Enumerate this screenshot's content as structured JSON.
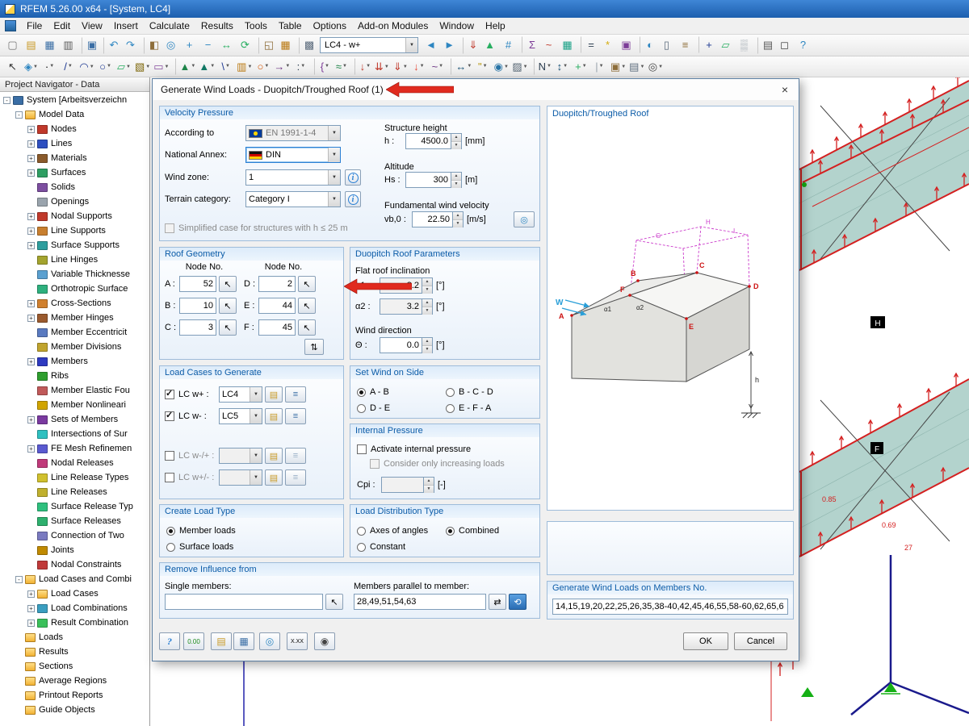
{
  "window": {
    "title": "RFEM 5.26.00 x64 - [System, LC4]"
  },
  "menu": {
    "items": [
      "File",
      "Edit",
      "View",
      "Insert",
      "Calculate",
      "Results",
      "Tools",
      "Table",
      "Options",
      "Add-on Modules",
      "Window",
      "Help"
    ]
  },
  "toolbar1": {
    "combo_value": "LC4 - w+",
    "left": [
      {
        "n": "new-file-icon",
        "g": "▢",
        "c": "#777777"
      },
      {
        "n": "open-file-icon",
        "g": "▤",
        "c": "#c99a27"
      },
      {
        "n": "save-icon",
        "g": "▦",
        "c": "#3a6ea5"
      },
      {
        "n": "print-icon",
        "g": "▥",
        "c": "#5a5a5a"
      },
      {
        "n": "copy-icon",
        "g": "▣",
        "c": "#3a6ea5",
        "sep": true
      },
      {
        "n": "undo-icon",
        "g": "↶",
        "c": "#2e86c1",
        "sep": true
      },
      {
        "n": "redo-icon",
        "g": "↷",
        "c": "#2e86c1"
      },
      {
        "n": "render-mode-icon",
        "g": "◧",
        "c": "#8e6e3a",
        "sep": true
      },
      {
        "n": "zoom-window-icon",
        "g": "◎",
        "c": "#2e86c1"
      },
      {
        "n": "zoom-in-icon",
        "g": "+",
        "c": "#2e86c1"
      },
      {
        "n": "zoom-out-icon",
        "g": "−",
        "c": "#2e86c1"
      },
      {
        "n": "move-view-icon",
        "g": "↔",
        "c": "#27ae60"
      },
      {
        "n": "rotate-view-icon",
        "g": "⟳",
        "c": "#27ae60"
      },
      {
        "n": "isometric-view-icon",
        "g": "◱",
        "c": "#8e6e3a",
        "sep": true
      },
      {
        "n": "tables-icon",
        "g": "▦",
        "c": "#b9770e"
      },
      {
        "n": "snap-grid-icon",
        "g": "▩",
        "c": "#5d6d7e",
        "sep": true
      }
    ],
    "right": [
      {
        "n": "previous-load-case-icon",
        "g": "◄",
        "c": "#2e86c1"
      },
      {
        "n": "next-load-case-icon",
        "g": "►",
        "c": "#2e86c1"
      },
      {
        "n": "show-loads-icon",
        "g": "⇓",
        "c": "#c0392b",
        "sep": true
      },
      {
        "n": "show-supports-icon",
        "g": "▲",
        "c": "#27ae60"
      },
      {
        "n": "show-numbering-icon",
        "g": "#",
        "c": "#2e86c1"
      },
      {
        "n": "show-values-icon",
        "g": "Σ",
        "c": "#7d3c98",
        "sep": true
      },
      {
        "n": "show-results-icon",
        "g": "~",
        "c": "#c0392b"
      },
      {
        "n": "fe-mesh-icon",
        "g": "▦",
        "c": "#16a085"
      },
      {
        "n": "calculation-icon",
        "g": "=",
        "c": "#2c3e50",
        "sep": true
      },
      {
        "n": "generators-icon",
        "g": "*",
        "c": "#d4ac0d"
      },
      {
        "n": "modules-icon",
        "g": "▣",
        "c": "#7d3c98"
      },
      {
        "n": "display-properties-icon",
        "g": "◐",
        "c": "#2e86c1",
        "sep": true
      },
      {
        "n": "control-panel-icon",
        "g": "▯",
        "c": "#5d6d7e"
      },
      {
        "n": "layers-icon",
        "g": "≡",
        "c": "#8e6e3a"
      },
      {
        "n": "axes-icon",
        "g": "+",
        "c": "#1f3a93",
        "sep": true
      },
      {
        "n": "work-plane-icon",
        "g": "▱",
        "c": "#27ae60"
      },
      {
        "n": "background-icon",
        "g": "▒",
        "c": "#9aa4ad"
      },
      {
        "n": "print-preview-icon",
        "g": "▤",
        "c": "#5a5a5a",
        "sep": true
      },
      {
        "n": "full-screen-icon",
        "g": "◻",
        "c": "#444444"
      },
      {
        "n": "help-icon",
        "g": "?",
        "c": "#2e86c1"
      }
    ]
  },
  "toolbar2": {
    "icons": [
      {
        "n": "select-icon",
        "g": "↖",
        "c": "#333333"
      },
      {
        "n": "snap-node-icon",
        "g": "◈",
        "c": "#2e86c1",
        "d": true
      },
      {
        "n": "node-icon",
        "g": "·",
        "c": "#000000",
        "d": true
      },
      {
        "n": "line-icon",
        "g": "/",
        "c": "#1f3a93",
        "d": true
      },
      {
        "n": "arc-icon",
        "g": "◠",
        "c": "#1f3a93",
        "d": true
      },
      {
        "n": "circle-icon",
        "g": "○",
        "c": "#1f3a93",
        "d": true
      },
      {
        "n": "surface-icon",
        "g": "▱",
        "c": "#27ae60",
        "d": true
      },
      {
        "n": "solid-icon",
        "g": "▧",
        "c": "#7d6608",
        "d": true
      },
      {
        "n": "opening-icon",
        "g": "▭",
        "c": "#884ea0",
        "d": true
      },
      {
        "n": "nodal-support-icon",
        "g": "▲",
        "c": "#1e8449",
        "d": true,
        "sep": true
      },
      {
        "n": "line-support-icon",
        "g": "▲",
        "c": "#117864",
        "d": true
      },
      {
        "n": "member-icon",
        "g": "\\",
        "c": "#1f3a93",
        "d": true
      },
      {
        "n": "cross-section-icon",
        "g": "▥",
        "c": "#b9770e",
        "d": true
      },
      {
        "n": "hinge-icon",
        "g": "○",
        "c": "#d35400",
        "d": true
      },
      {
        "n": "eccentricity-icon",
        "g": "→",
        "c": "#6c3483",
        "d": true
      },
      {
        "n": "division-icon",
        "g": ":",
        "c": "#2c3e50",
        "d": true
      },
      {
        "n": "set-of-members-icon",
        "g": "{",
        "c": "#7d3c98",
        "d": true,
        "sep": true
      },
      {
        "n": "rib-icon",
        "g": "≈",
        "c": "#1e8449",
        "d": true
      },
      {
        "n": "nodal-load-icon",
        "g": "↓",
        "c": "#c0392b",
        "d": true,
        "sep": true
      },
      {
        "n": "member-load-icon",
        "g": "⇊",
        "c": "#c0392b",
        "d": true
      },
      {
        "n": "surface-load-icon",
        "g": "⇓",
        "c": "#c0392b",
        "d": true
      },
      {
        "n": "free-load-icon",
        "g": "↓",
        "c": "#e74c3c",
        "d": true
      },
      {
        "n": "imperfection-icon",
        "g": "~",
        "c": "#6c3483",
        "d": true
      },
      {
        "n": "dimension-icon",
        "g": "↔",
        "c": "#1a5276",
        "d": true,
        "sep": true
      },
      {
        "n": "comment-icon",
        "g": "\"",
        "c": "#b7950b",
        "d": true
      },
      {
        "n": "visibility-icon",
        "g": "◉",
        "c": "#2874a6",
        "d": true
      },
      {
        "n": "clipping-plane-icon",
        "g": "▨",
        "c": "#566573",
        "d": true
      },
      {
        "n": "renumber-icon",
        "g": "N",
        "c": "#2c3e50",
        "d": true,
        "sep": true
      },
      {
        "n": "measure-icon",
        "g": "↕",
        "c": "#1a5276",
        "d": true
      },
      {
        "n": "coordinate-system-icon",
        "g": "+",
        "c": "#27ae60",
        "d": true
      },
      {
        "n": "guideline-icon",
        "g": "|",
        "c": "#9aa4ad",
        "d": true
      },
      {
        "n": "block-icon",
        "g": "▣",
        "c": "#8e6e3a",
        "d": true
      },
      {
        "n": "dxf-icon",
        "g": "▤",
        "c": "#5d6d7e",
        "d": true
      },
      {
        "n": "settings-icon",
        "g": "◎",
        "c": "#444444",
        "d": true
      }
    ]
  },
  "navigator": {
    "title": "Project Navigator - Data",
    "tree": [
      {
        "label": "System [Arbeitsverzeichn",
        "lvl": 0,
        "exp": "-",
        "c": "#3a6ea5"
      },
      {
        "label": "Model Data",
        "lvl": 1,
        "exp": "-",
        "folder": true
      },
      {
        "label": "Nodes",
        "lvl": 2,
        "exp": "+",
        "c": "#c0392b"
      },
      {
        "label": "Lines",
        "lvl": 2,
        "exp": "+",
        "c": "#2e4fc0"
      },
      {
        "label": "Materials",
        "lvl": 2,
        "exp": "+",
        "c": "#8a5a2b"
      },
      {
        "label": "Surfaces",
        "lvl": 2,
        "exp": "+",
        "c": "#2e9e62"
      },
      {
        "label": "Solids",
        "lvl": 2,
        "exp": "",
        "c": "#7d4fa0"
      },
      {
        "label": "Openings",
        "lvl": 2,
        "exp": "",
        "c": "#9aa4ad"
      },
      {
        "label": "Nodal Supports",
        "lvl": 2,
        "exp": "+",
        "c": "#c0392b"
      },
      {
        "label": "Line Supports",
        "lvl": 2,
        "exp": "+",
        "c": "#c87f2f"
      },
      {
        "label": "Surface Supports",
        "lvl": 2,
        "exp": "+",
        "c": "#2e9e9e"
      },
      {
        "label": "Line Hinges",
        "lvl": 2,
        "exp": "",
        "c": "#a4a42e"
      },
      {
        "label": "Variable Thicknesse",
        "lvl": 2,
        "exp": "",
        "c": "#5aa0d0"
      },
      {
        "label": "Orthotropic Surface",
        "lvl": 2,
        "exp": "",
        "c": "#2eb07e"
      },
      {
        "label": "Cross-Sections",
        "lvl": 2,
        "exp": "+",
        "c": "#d0802e"
      },
      {
        "label": "Member Hinges",
        "lvl": 2,
        "exp": "+",
        "c": "#9a5a2e"
      },
      {
        "label": "Member Eccentricit",
        "lvl": 2,
        "exp": "",
        "c": "#5a7ac0"
      },
      {
        "label": "Member Divisions",
        "lvl": 2,
        "exp": "",
        "c": "#c0a42e"
      },
      {
        "label": "Members",
        "lvl": 2,
        "exp": "+",
        "c": "#2e3ac0"
      },
      {
        "label": "Ribs",
        "lvl": 2,
        "exp": "",
        "c": "#2e9e2e"
      },
      {
        "label": "Member Elastic Fou",
        "lvl": 2,
        "exp": "",
        "c": "#c05a5a"
      },
      {
        "label": "Member Nonlineari",
        "lvl": 2,
        "exp": "",
        "c": "#d0a400"
      },
      {
        "label": "Sets of Members",
        "lvl": 2,
        "exp": "+",
        "c": "#7a3aa0"
      },
      {
        "label": "Intersections of Sur",
        "lvl": 2,
        "exp": "",
        "c": "#2ec0c0"
      },
      {
        "label": "FE Mesh Refinemen",
        "lvl": 2,
        "exp": "+",
        "c": "#5a5ad0"
      },
      {
        "label": "Nodal Releases",
        "lvl": 2,
        "exp": "",
        "c": "#c03a7a"
      },
      {
        "label": "Line Release Types",
        "lvl": 2,
        "exp": "",
        "c": "#d0c02e"
      },
      {
        "label": "Line Releases",
        "lvl": 2,
        "exp": "",
        "c": "#c0b02e"
      },
      {
        "label": "Surface Release Typ",
        "lvl": 2,
        "exp": "",
        "c": "#2ec07e"
      },
      {
        "label": "Surface Releases",
        "lvl": 2,
        "exp": "",
        "c": "#2eb06e"
      },
      {
        "label": "Connection of Two",
        "lvl": 2,
        "exp": "",
        "c": "#7a7ac0"
      },
      {
        "label": "Joints",
        "lvl": 2,
        "exp": "",
        "c": "#c08a00"
      },
      {
        "label": "Nodal Constraints",
        "lvl": 2,
        "exp": "",
        "c": "#c03a3a"
      },
      {
        "label": "Load Cases and Combi",
        "lvl": 1,
        "exp": "-",
        "folder": true
      },
      {
        "label": "Load Cases",
        "lvl": 2,
        "exp": "+",
        "folder": true
      },
      {
        "label": "Load Combinations",
        "lvl": 2,
        "exp": "+",
        "c": "#3a9ec0"
      },
      {
        "label": "Result Combination",
        "lvl": 2,
        "exp": "+",
        "c": "#3ac05a"
      },
      {
        "label": "Loads",
        "lvl": 1,
        "exp": "",
        "folder": true
      },
      {
        "label": "Results",
        "lvl": 1,
        "exp": "",
        "folder": true
      },
      {
        "label": "Sections",
        "lvl": 1,
        "exp": "",
        "folder": true
      },
      {
        "label": "Average Regions",
        "lvl": 1,
        "exp": "",
        "folder": true
      },
      {
        "label": "Printout Reports",
        "lvl": 1,
        "exp": "",
        "folder": true
      },
      {
        "label": "Guide Objects",
        "lvl": 1,
        "exp": "",
        "folder": true
      }
    ]
  },
  "dialog": {
    "title": "Generate Wind Loads - Duopitch/Troughed Roof (1)",
    "close_label": "×",
    "groups": {
      "velocity_pressure": {
        "title": "Velocity Pressure",
        "according_label": "According to",
        "according_value": "EN 1991-1-4",
        "annex_label": "National Annex:",
        "annex_value": "DIN",
        "wind_zone_label": "Wind zone:",
        "wind_zone_value": "1",
        "terrain_label": "Terrain category:",
        "terrain_value": "Category I",
        "simplified_label": "Simplified case for structures with h ≤ 25 m",
        "structure_height_label": "Structure height",
        "h_label": "h :",
        "h_value": "4500.0",
        "h_unit": "[mm]",
        "altitude_label": "Altitude",
        "hs_label": "Hs :",
        "hs_value": "300",
        "hs_unit": "[m]",
        "fundamental_label": "Fundamental wind velocity",
        "vb_label": "vb,0 :",
        "vb_value": "22.50",
        "vb_unit": "[m/s]"
      },
      "roof_geometry": {
        "title": "Roof Geometry",
        "col1_header": "Node No.",
        "col2_header": "Node No.",
        "a_label": "A :",
        "a_value": "52",
        "b_label": "B :",
        "b_value": "10",
        "c_label": "C :",
        "c_value": "3",
        "d_label": "D :",
        "d_value": "2",
        "e_label": "E :",
        "e_value": "44",
        "f_label": "F :",
        "f_value": "45"
      },
      "duopitch_params": {
        "title": "Duopitch Roof Parameters",
        "flat_label": "Flat roof inclination",
        "a1_label": "α1 :",
        "a1_value": "3.2",
        "a1_unit": "[°]",
        "a2_label": "α2 :",
        "a2_value": "3.2",
        "a2_unit": "[°]",
        "wind_dir_label": "Wind direction",
        "theta_label": "Θ :",
        "theta_value": "0.0",
        "theta_unit": "[°]"
      },
      "load_cases": {
        "title": "Load Cases to Generate",
        "rows": [
          {
            "label": "LC w+ :",
            "value": "LC4",
            "checked": true
          },
          {
            "label": "LC w- :",
            "value": "LC5",
            "checked": true
          },
          {
            "label": "LC w-/+ :",
            "value": "",
            "checked": false
          },
          {
            "label": "LC w+/- :",
            "value": "",
            "checked": false
          }
        ]
      },
      "wind_side": {
        "title": "Set Wind on Side",
        "options": [
          {
            "label": "A - B",
            "selected": true
          },
          {
            "label": "B - C - D",
            "selected": false
          },
          {
            "label": "D - E",
            "selected": false
          },
          {
            "label": "E - F - A",
            "selected": false
          }
        ]
      },
      "internal_pressure": {
        "title": "Internal Pressure",
        "activate_label": "Activate internal pressure",
        "consider_label": "Consider only increasing loads",
        "cpi_label": "Cpi :",
        "cpi_unit": "[-]"
      },
      "create_load_type": {
        "title": "Create Load Type",
        "options": [
          {
            "label": "Member loads",
            "selected": true
          },
          {
            "label": "Surface loads",
            "selected": false
          }
        ]
      },
      "load_distribution": {
        "title": "Load Distribution Type",
        "options": [
          {
            "label": "Axes of angles",
            "selected": false
          },
          {
            "label": "Combined",
            "selected": true
          },
          {
            "label": "Constant",
            "selected": false
          }
        ]
      },
      "remove_influence": {
        "title": "Remove Influence from",
        "single_label": "Single members:",
        "single_value": "",
        "parallel_label": "Members parallel to member:",
        "parallel_value": "28,49,51,54,63"
      },
      "generate_members": {
        "title": "Generate Wind Loads on Members No.",
        "value": "14,15,19,20,22,25,26,35,38-40,42,45,46,55,58-60,62,65,6"
      }
    },
    "diagram": {
      "title": "Duopitch/Troughed Roof",
      "labels": {
        "A": "A",
        "B": "B",
        "C": "C",
        "D": "D",
        "E": "E",
        "F": "F",
        "G": "G",
        "H": "H",
        "I": "I",
        "W": "W",
        "h": "h",
        "a1": "α1",
        "a2": "α2"
      }
    },
    "buttons": {
      "ok": "OK",
      "cancel": "Cancel",
      "decimals_label": "0.00",
      "xxx_label": "X.XX"
    }
  },
  "viewport": {
    "labels": {
      "h_box": "H",
      "f_box": "F",
      "v1": "0.85",
      "v2": "0.69",
      "v3": "27"
    }
  }
}
